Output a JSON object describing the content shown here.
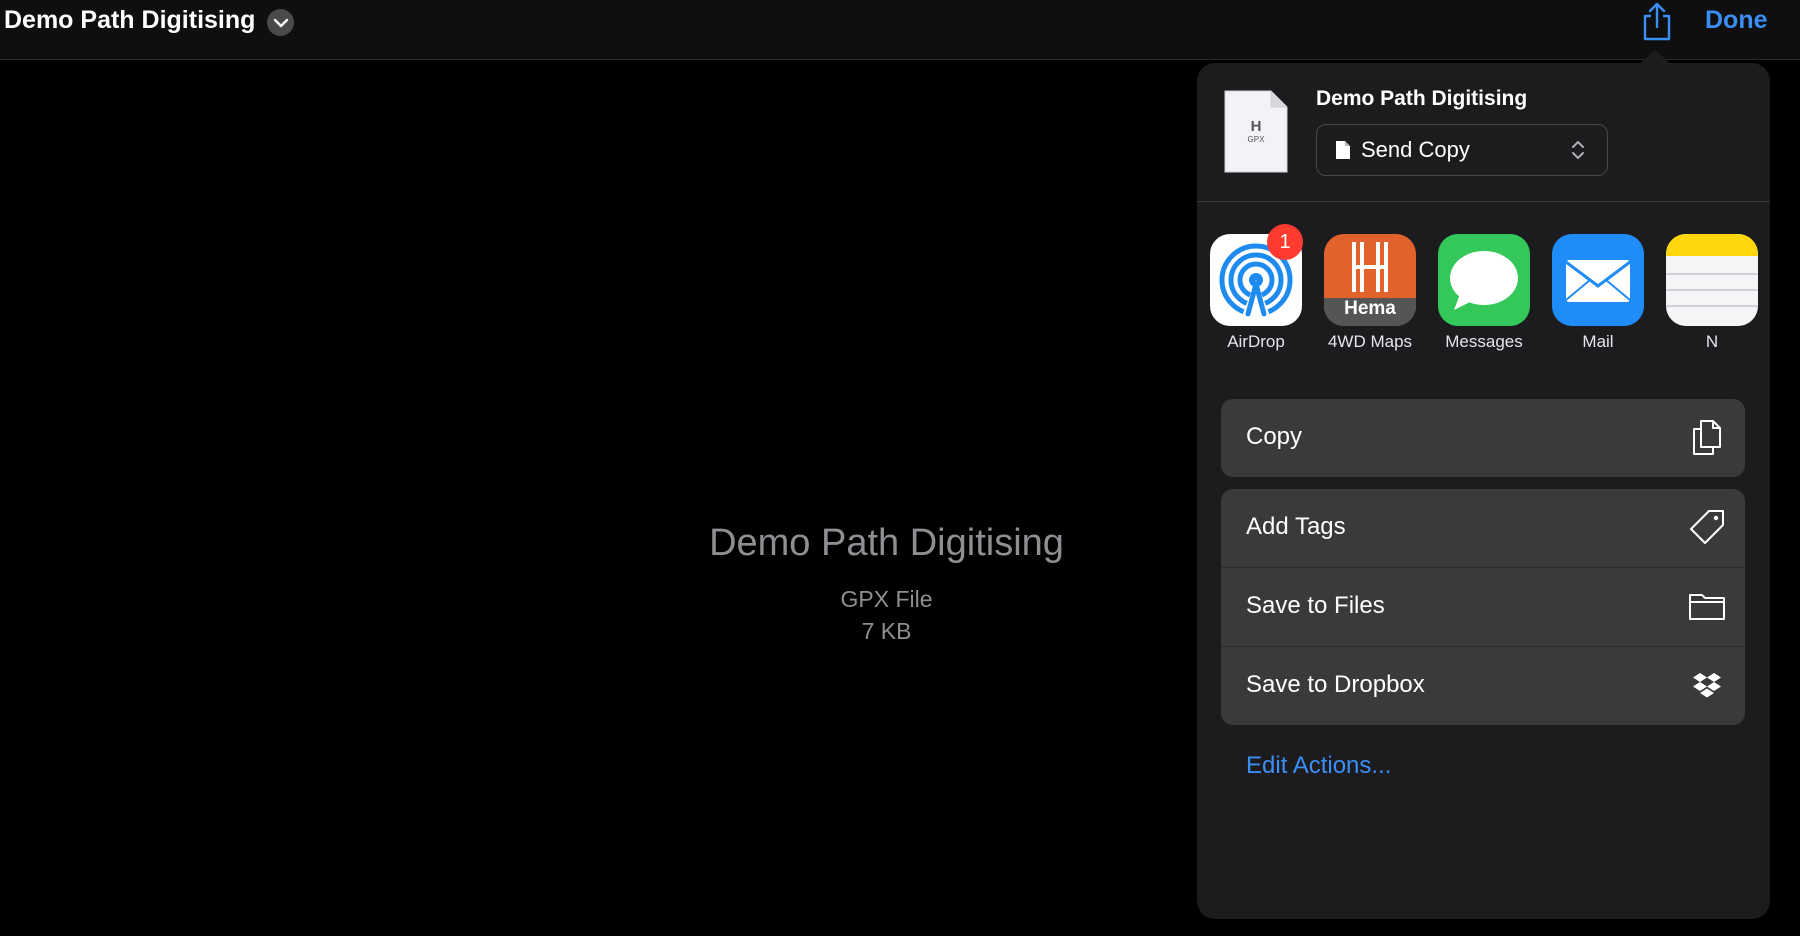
{
  "header": {
    "title": "Demo Path Digitising",
    "done_label": "Done"
  },
  "preview": {
    "name": "Demo Path Digitising",
    "type": "GPX File",
    "size": "7 KB"
  },
  "share_sheet": {
    "file_title": "Demo Path Digitising",
    "thumbnail_letter": "H",
    "thumbnail_ext": "GPX",
    "send_mode": "Send Copy",
    "apps": [
      {
        "label": "AirDrop",
        "badge": "1",
        "icon": "airdrop-icon",
        "color": "#1e8bf0"
      },
      {
        "label": "4WD Maps",
        "icon": "hema-icon",
        "icon_text": "Hema",
        "color": "#e2622c"
      },
      {
        "label": "Messages",
        "icon": "messages-icon",
        "color": "#34c759"
      },
      {
        "label": "Mail",
        "icon": "mail-icon",
        "color": "#1f8cf8"
      },
      {
        "label": "N",
        "icon": "notes-icon",
        "color": "#ffd60a"
      }
    ],
    "actions_primary": [
      {
        "label": "Copy",
        "icon": "copy-icon"
      }
    ],
    "actions_secondary": [
      {
        "label": "Add Tags",
        "icon": "tag-icon"
      },
      {
        "label": "Save to Files",
        "icon": "folder-icon"
      },
      {
        "label": "Save to Dropbox",
        "icon": "dropbox-icon"
      }
    ],
    "edit_actions_label": "Edit Actions..."
  },
  "colors": {
    "accent": "#3a8ef6",
    "popover_bg": "#1c1c1e",
    "row_bg": "#3a3a3c"
  }
}
